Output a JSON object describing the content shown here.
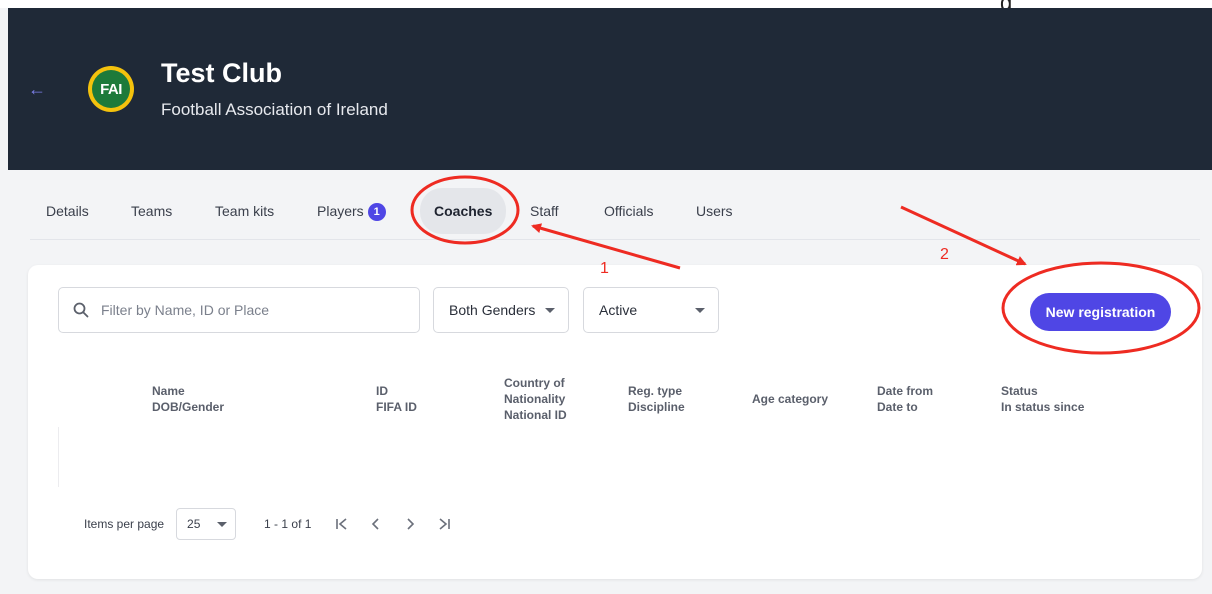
{
  "header": {
    "back_icon": "arrow-left-icon",
    "logo_text": "FAI",
    "club_name": "Test Club",
    "association": "Football Association of Ireland"
  },
  "tabs": [
    {
      "label": "Details"
    },
    {
      "label": "Teams"
    },
    {
      "label": "Team kits"
    },
    {
      "label": "Players",
      "badge": "1"
    },
    {
      "label": "Coaches",
      "active": true
    },
    {
      "label": "Staff"
    },
    {
      "label": "Officials"
    },
    {
      "label": "Users"
    }
  ],
  "filters": {
    "search_placeholder": "Filter by Name, ID or Place",
    "gender_value": "Both Genders",
    "status_value": "Active"
  },
  "actions": {
    "new_registration": "New registration"
  },
  "table": {
    "columns": [
      [
        "Name",
        "DOB/Gender"
      ],
      [
        "ID",
        "FIFA ID"
      ],
      [
        "Country of",
        "Nationality",
        "National ID"
      ],
      [
        "Reg. type",
        "Discipline"
      ],
      [
        "Age category"
      ],
      [
        "Date from",
        "Date to"
      ],
      [
        "Status",
        "In status since"
      ]
    ]
  },
  "pagination": {
    "items_per_page_label": "Items per page",
    "items_per_page_value": "25",
    "range": "1 - 1 of 1"
  },
  "annotations": {
    "step1": "1",
    "step2": "2",
    "color": "#ee2b22"
  },
  "colors": {
    "header_bg": "#1f2937",
    "accent": "#4f46e5",
    "page_bg": "#f3f4f6"
  }
}
